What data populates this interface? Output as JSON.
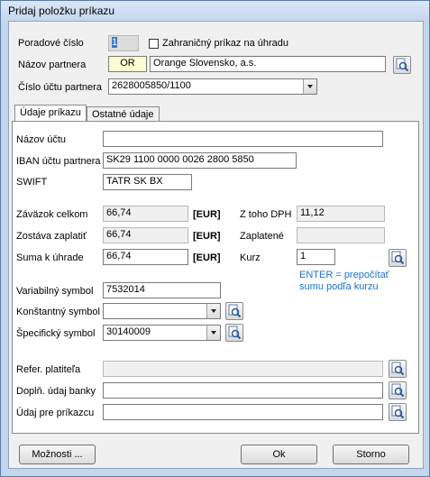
{
  "window": {
    "title": "Pridaj položku príkazu"
  },
  "top": {
    "order_no_label": "Poradové číslo",
    "order_no_value": "1",
    "foreign_checkbox_label": "Zahraničný príkaz na úhradu",
    "partner_label": "Názov partnera",
    "partner_code": "OR",
    "partner_name": "Orange Slovensko, a.s.",
    "account_label": "Číslo účtu partnera",
    "account_value": "2628005850/1100"
  },
  "tabs": [
    {
      "label": "Údaje príkazu",
      "active": true
    },
    {
      "label": "Ostatné údaje",
      "active": false
    }
  ],
  "form": {
    "account_name_label": "Názov účtu",
    "account_name_value": "",
    "iban_label": "IBAN účtu partnera",
    "iban_value": "SK29 1100 0000 0026 2800 5850",
    "swift_label": "SWIFT",
    "swift_value": "TATR SK BX",
    "liability_label": "Záväzok celkom",
    "liability_value": "66,74",
    "currency1": "[EUR]",
    "vat_label": "Z toho DPH",
    "vat_value": "11,12",
    "remaining_label": "Zostáva zaplatiť",
    "remaining_value": "66,74",
    "currency2": "[EUR]",
    "paid_label": "Zaplatené",
    "paid_value": "",
    "amount_label": "Suma k úhrade",
    "amount_value": "66,74",
    "currency3": "[EUR]",
    "rate_label": "Kurz",
    "rate_value": "1",
    "hint_line1": "ENTER = prepočítať",
    "hint_line2": "sumu podľa kurzu",
    "variable_label": "Variabilný symbol",
    "variable_value": "7532014",
    "constant_label": "Konštantný symbol",
    "constant_value": "",
    "specific_label": "Špecifický symbol",
    "specific_value": "30140009",
    "payer_ref_label": "Refer. platiteľa",
    "payer_ref_value": "",
    "bank_info_label": "Doplň. údaj banky",
    "bank_info_value": "",
    "payee_info_label": "Údaj pre príkazcu",
    "payee_info_value": ""
  },
  "buttons": {
    "options": "Možnosti ...",
    "ok": "Ok",
    "cancel": "Storno"
  },
  "icons": {
    "lookup": "search-icon",
    "dropdown": "chevron-down-icon"
  }
}
